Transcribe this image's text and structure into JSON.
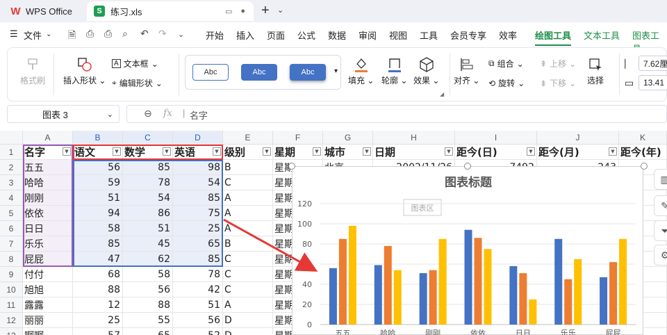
{
  "titlebar": {
    "app_name": "WPS Office",
    "file_name": "练习.xls",
    "app_logo": "W",
    "file_logo": "S"
  },
  "menu": {
    "file_label": "文件",
    "tabs": [
      "开始",
      "插入",
      "页面",
      "公式",
      "数据",
      "审阅",
      "视图",
      "工具",
      "会员专享",
      "效率",
      "绘图工具",
      "文本工具",
      "图表工具"
    ],
    "active_tab": "绘图工具"
  },
  "ribbon": {
    "format_painter": "格式刷",
    "insert_shape": "插入形状",
    "text_box": "文本框",
    "edit_shape": "编辑形状",
    "style_samples": [
      "Abc",
      "Abc",
      "Abc"
    ],
    "fill": "填充",
    "outline": "轮廓",
    "effects": "效果",
    "align": "对齐",
    "group": "组合",
    "rotate": "旋转",
    "bring_forward": "上移",
    "send_backward": "下移",
    "select": "选择",
    "height_value": "7.62厘",
    "width_value": "13.41"
  },
  "formula_bar": {
    "name_box": "图表 3",
    "formula": "名字"
  },
  "grid": {
    "columns": [
      "A",
      "B",
      "C",
      "D",
      "E",
      "F",
      "G",
      "H",
      "I",
      "J",
      "K"
    ],
    "headers": [
      "名字",
      "语文",
      "数学",
      "英语",
      "级别",
      "星期",
      "城市",
      "日期",
      "距今(日)",
      "距今(月)",
      "距今(年)"
    ],
    "rows": [
      {
        "num": "2",
        "name": "五五",
        "chinese": "56",
        "math": "85",
        "english": "98",
        "level": "B",
        "week": "星期一",
        "city": "北京",
        "date": "2002/11/26",
        "days": "7492",
        "months": "243"
      },
      {
        "num": "3",
        "name": "哈哈",
        "chinese": "59",
        "math": "78",
        "english": "54",
        "level": "C",
        "week": "星期"
      },
      {
        "num": "4",
        "name": "刚刚",
        "chinese": "51",
        "math": "54",
        "english": "85",
        "level": "A",
        "week": "星期"
      },
      {
        "num": "5",
        "name": "依依",
        "chinese": "94",
        "math": "86",
        "english": "75",
        "level": "A",
        "week": "星期"
      },
      {
        "num": "6",
        "name": "日日",
        "chinese": "58",
        "math": "51",
        "english": "25",
        "level": "A",
        "week": "星期"
      },
      {
        "num": "7",
        "name": "乐乐",
        "chinese": "85",
        "math": "45",
        "english": "65",
        "level": "B",
        "week": "星期"
      },
      {
        "num": "8",
        "name": "屁屁",
        "chinese": "47",
        "math": "62",
        "english": "85",
        "level": "C",
        "week": "星期"
      },
      {
        "num": "9",
        "name": "付付",
        "chinese": "68",
        "math": "58",
        "english": "78",
        "level": "C",
        "week": "星期"
      },
      {
        "num": "10",
        "name": "旭旭",
        "chinese": "88",
        "math": "56",
        "english": "42",
        "level": "C",
        "week": "星期"
      },
      {
        "num": "11",
        "name": "露露",
        "chinese": "12",
        "math": "88",
        "english": "51",
        "level": "A",
        "week": "星期"
      },
      {
        "num": "12",
        "name": "丽丽",
        "chinese": "25",
        "math": "55",
        "english": "56",
        "level": "D",
        "week": "星期"
      },
      {
        "num": "13",
        "name": "啊啊",
        "chinese": "57",
        "math": "65",
        "english": "52",
        "level": "D",
        "week": "星期"
      }
    ],
    "header_row_num": "1"
  },
  "chart_data": {
    "type": "bar",
    "title": "图表标题",
    "area_label": "图表区",
    "categories": [
      "五五",
      "哈哈",
      "刚刚",
      "依依",
      "日日",
      "乐乐",
      "屁屁"
    ],
    "series": [
      {
        "color": "#4472c4",
        "values": [
          56,
          59,
          51,
          94,
          58,
          85,
          47
        ]
      },
      {
        "color": "#ed7d31",
        "values": [
          85,
          78,
          54,
          86,
          51,
          45,
          62
        ]
      },
      {
        "color": "#ffc000",
        "values": [
          98,
          54,
          85,
          75,
          25,
          65,
          85
        ]
      }
    ],
    "ylim": [
      0,
      120
    ],
    "yticks": [
      "0",
      "20",
      "40",
      "60",
      "80",
      "100",
      "120"
    ],
    "grid": true
  }
}
